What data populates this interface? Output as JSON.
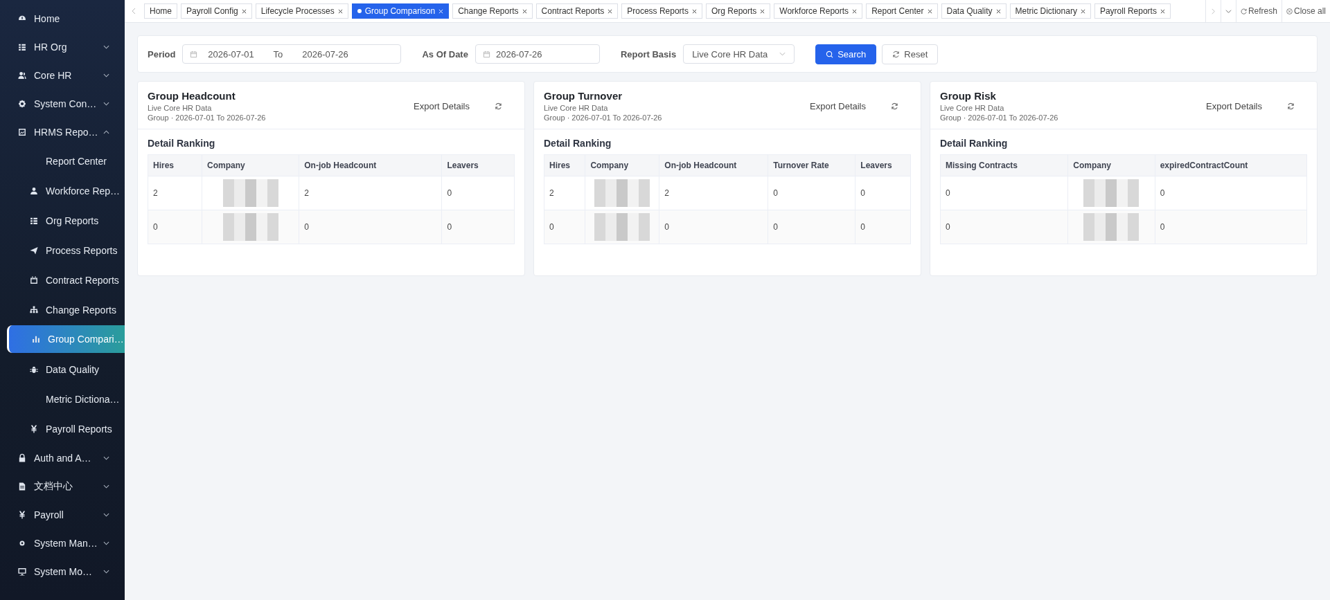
{
  "sidebar": {
    "items": [
      {
        "label": "Home",
        "selected": false
      },
      {
        "label": "HR Org",
        "selected": false,
        "expanded": false
      },
      {
        "label": "Core HR",
        "selected": false,
        "expanded": false
      },
      {
        "label": "System Con…",
        "selected": false,
        "expanded": false
      },
      {
        "label": "HRMS Repo…",
        "selected": false,
        "expanded": true,
        "children": [
          {
            "label": "Report Center",
            "selected": false,
            "icon": false
          },
          {
            "label": "Workforce Rep…",
            "selected": false,
            "icon": true
          },
          {
            "label": "Org Reports",
            "selected": false,
            "icon": true
          },
          {
            "label": "Process Reports",
            "selected": false,
            "icon": true
          },
          {
            "label": "Contract Reports",
            "selected": false,
            "icon": true
          },
          {
            "label": "Change Reports",
            "selected": false,
            "icon": true
          },
          {
            "label": "Group Compari…",
            "selected": true,
            "icon": true
          },
          {
            "label": "Data Quality",
            "selected": false,
            "icon": true
          },
          {
            "label": "Metric Dictiona…",
            "selected": false,
            "icon": false
          },
          {
            "label": "Payroll Reports",
            "selected": false,
            "icon": true
          }
        ]
      },
      {
        "label": "Auth and A…",
        "selected": false,
        "expanded": false
      },
      {
        "label": "文档中心",
        "selected": false,
        "expanded": false
      },
      {
        "label": "Payroll",
        "selected": false,
        "expanded": false
      },
      {
        "label": "System Man…",
        "selected": false,
        "expanded": false
      },
      {
        "label": "System Mo…",
        "selected": false,
        "expanded": false
      }
    ]
  },
  "tabs": [
    {
      "label": "Home",
      "selected": false,
      "closable": false
    },
    {
      "label": "Payroll Config",
      "selected": false,
      "closable": true
    },
    {
      "label": "Lifecycle Processes",
      "selected": false,
      "closable": true
    },
    {
      "label": "Group Comparison",
      "selected": true,
      "closable": true
    },
    {
      "label": "Change Reports",
      "selected": false,
      "closable": true
    },
    {
      "label": "Contract Reports",
      "selected": false,
      "closable": true
    },
    {
      "label": "Process Reports",
      "selected": false,
      "closable": true
    },
    {
      "label": "Org Reports",
      "selected": false,
      "closable": true
    },
    {
      "label": "Workforce Reports",
      "selected": false,
      "closable": true
    },
    {
      "label": "Report Center",
      "selected": false,
      "closable": true
    },
    {
      "label": "Data Quality",
      "selected": false,
      "closable": true
    },
    {
      "label": "Metric Dictionary",
      "selected": false,
      "closable": true
    },
    {
      "label": "Payroll Reports",
      "selected": false,
      "closable": true
    }
  ],
  "tab_actions": {
    "refresh": "Refresh",
    "close_all": "Close all"
  },
  "filters": {
    "period_label": "Period",
    "period_start": "2026-07-01",
    "period_separator": "To",
    "period_end": "2026-07-26",
    "as_of_label": "As Of Date",
    "as_of_value": "2026-07-26",
    "basis_label": "Report Basis",
    "basis_value": "Live Core HR Data",
    "search": "Search",
    "reset": "Reset"
  },
  "cards": [
    {
      "title": "Group Headcount",
      "source": "Live Core HR Data",
      "scope": "Group · 2026-07-01 To 2026-07-26",
      "export": "Export Details",
      "section": "Detail Ranking",
      "columns": [
        {
          "label": "Hires",
          "kind": "text"
        },
        {
          "label": "Company",
          "kind": "redacted"
        },
        {
          "label": "On-job Headcount",
          "kind": "text"
        },
        {
          "label": "Leavers",
          "kind": "text"
        }
      ],
      "rows": [
        [
          "2",
          null,
          "2",
          "0"
        ],
        [
          "0",
          null,
          "0",
          "0"
        ]
      ]
    },
    {
      "title": "Group Turnover",
      "source": "Live Core HR Data",
      "scope": "Group · 2026-07-01 To 2026-07-26",
      "export": "Export Details",
      "section": "Detail Ranking",
      "columns": [
        {
          "label": "Hires",
          "kind": "text"
        },
        {
          "label": "Company",
          "kind": "redacted"
        },
        {
          "label": "On-job Headcount",
          "kind": "text"
        },
        {
          "label": "Turnover Rate",
          "kind": "text"
        },
        {
          "label": "Leavers",
          "kind": "text"
        }
      ],
      "rows": [
        [
          "2",
          null,
          "2",
          "0",
          "0"
        ],
        [
          "0",
          null,
          "0",
          "0",
          "0"
        ]
      ]
    },
    {
      "title": "Group Risk",
      "source": "Live Core HR Data",
      "scope": "Group · 2026-07-01 To 2026-07-26",
      "export": "Export Details",
      "section": "Detail Ranking",
      "columns": [
        {
          "label": "Missing Contracts",
          "kind": "text"
        },
        {
          "label": "Company",
          "kind": "redacted"
        },
        {
          "label": "expiredContractCount",
          "kind": "text"
        }
      ],
      "rows": [
        [
          "0",
          null,
          "0"
        ],
        [
          "0",
          null,
          "0"
        ]
      ]
    }
  ]
}
